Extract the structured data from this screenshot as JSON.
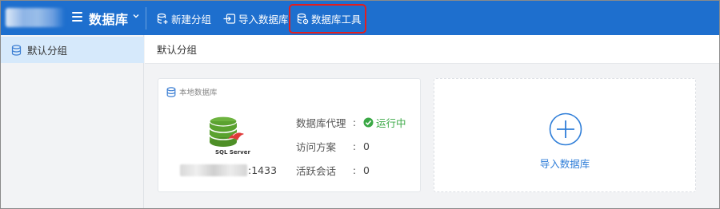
{
  "header": {
    "app_title": "数据库",
    "toolbar": {
      "new_group": "新建分组",
      "import_db": "导入数据库",
      "db_tools": "数据库工具"
    },
    "highlight_color": "#e41e1e",
    "bar_color": "#1e6fce"
  },
  "sidebar": {
    "items": [
      {
        "label": "默认分组",
        "icon": "database-icon",
        "selected": true
      }
    ]
  },
  "main": {
    "breadcrumb": "默认分组",
    "db_card": {
      "label": "本地数据库",
      "engine_name": "SQL Server",
      "port": ":1433",
      "rows": [
        {
          "key": "数据库代理",
          "value": "运行中",
          "status_color": "#3aa845"
        },
        {
          "key": "访问方案",
          "value": "0"
        },
        {
          "key": "活跃会话",
          "value": "0"
        }
      ]
    },
    "add_card": {
      "label": "导入数据库"
    }
  }
}
